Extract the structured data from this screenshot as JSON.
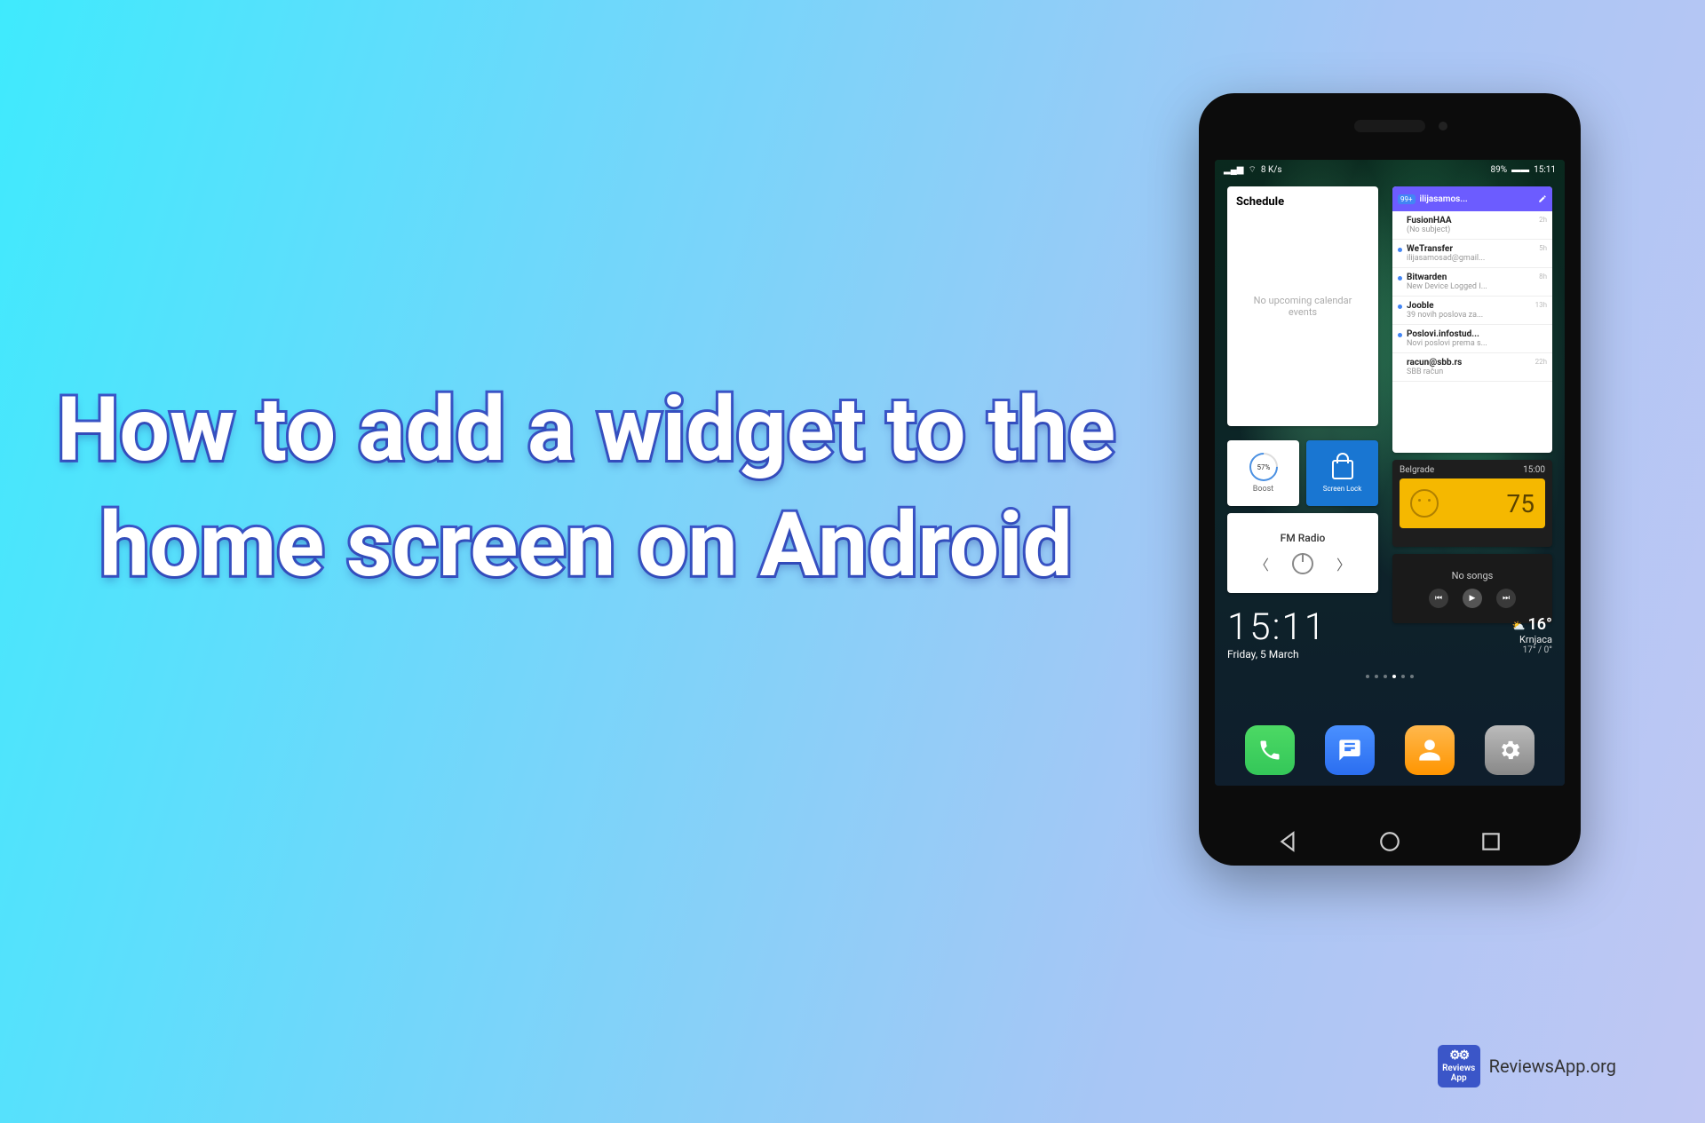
{
  "headline": "How to add a widget to the home screen on Android",
  "footer": {
    "logo_top": "Reviews",
    "logo_bottom": "App",
    "site": "ReviewsApp.org"
  },
  "phone": {
    "statusbar": {
      "signal": "▂▄▆",
      "wifi": "8 K/s",
      "battery": "89%",
      "time": "15:11"
    },
    "schedule": {
      "title": "Schedule",
      "empty": "No upcoming calendar events"
    },
    "email": {
      "account": "ilijasamos...",
      "badge": "99+",
      "items": [
        {
          "sender": "FusionHAA",
          "subject": "(No subject)",
          "time": "2h",
          "unread": false
        },
        {
          "sender": "WeTransfer",
          "subject": "ilijasamosad@gmail...",
          "time": "5h",
          "unread": true
        },
        {
          "sender": "Bitwarden",
          "subject": "New Device Logged I...",
          "time": "8h",
          "unread": true
        },
        {
          "sender": "Jooble",
          "subject": "39 novih poslova za...",
          "time": "13h",
          "unread": true
        },
        {
          "sender": "Poslovi.infostud...",
          "subject": "Novi poslovi prema s...",
          "time": "",
          "unread": true
        },
        {
          "sender": "racun@sbb.rs",
          "subject": "SBB račun",
          "time": "22h",
          "unread": false
        }
      ]
    },
    "boost": {
      "value": "57%",
      "label": "Boost"
    },
    "lock": {
      "label": "Screen Lock"
    },
    "radio": {
      "title": "FM Radio"
    },
    "weather_widget": {
      "city": "Belgrade",
      "updated": "15:00",
      "aqi": "75"
    },
    "music": {
      "title": "No songs"
    },
    "clock": {
      "time": "15:11",
      "date": "Friday, 5 March"
    },
    "weather_small": {
      "temp": "16°",
      "location": "Krnjaca",
      "range": "17° / 0°"
    }
  }
}
